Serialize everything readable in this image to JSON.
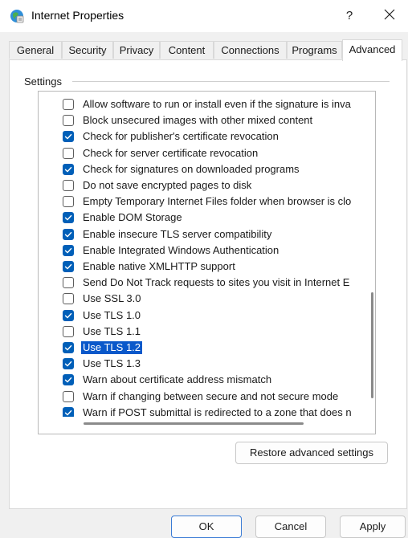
{
  "window": {
    "title": "Internet Properties",
    "help_glyph": "?"
  },
  "tabs": [
    {
      "label": "General"
    },
    {
      "label": "Security"
    },
    {
      "label": "Privacy"
    },
    {
      "label": "Content"
    },
    {
      "label": "Connections"
    },
    {
      "label": "Programs"
    },
    {
      "label": "Advanced",
      "active": true
    }
  ],
  "settings": {
    "group_label": "Settings",
    "items": [
      {
        "label": "Allow software to run or install even if the signature is inva",
        "checked": false
      },
      {
        "label": "Block unsecured images with other mixed content",
        "checked": false
      },
      {
        "label": "Check for publisher's certificate revocation",
        "checked": true
      },
      {
        "label": "Check for server certificate revocation",
        "checked": false
      },
      {
        "label": "Check for signatures on downloaded programs",
        "checked": true
      },
      {
        "label": "Do not save encrypted pages to disk",
        "checked": false
      },
      {
        "label": "Empty Temporary Internet Files folder when browser is clo",
        "checked": false
      },
      {
        "label": "Enable DOM Storage",
        "checked": true
      },
      {
        "label": "Enable insecure TLS server compatibility",
        "checked": true
      },
      {
        "label": "Enable Integrated Windows Authentication",
        "checked": true
      },
      {
        "label": "Enable native XMLHTTP support",
        "checked": true
      },
      {
        "label": "Send Do Not Track requests to sites you visit in Internet E",
        "checked": false
      },
      {
        "label": "Use SSL 3.0",
        "checked": false
      },
      {
        "label": "Use TLS 1.0",
        "checked": true
      },
      {
        "label": "Use TLS 1.1",
        "checked": false
      },
      {
        "label": "Use TLS 1.2",
        "checked": true,
        "selected": true
      },
      {
        "label": "Use TLS 1.3",
        "checked": true
      },
      {
        "label": "Warn about certificate address mismatch",
        "checked": true
      },
      {
        "label": "Warn if changing between secure and not secure mode",
        "checked": false
      },
      {
        "label": "Warn if POST submittal is redirected to a zone that does n",
        "checked": true
      }
    ]
  },
  "buttons": {
    "restore": "Restore advanced settings",
    "ok": "OK",
    "cancel": "Cancel",
    "apply": "Apply"
  },
  "colors": {
    "checkbox_checked": "#005fb8",
    "selection": "#0a58ca",
    "ok_border": "#3a7bd5"
  }
}
